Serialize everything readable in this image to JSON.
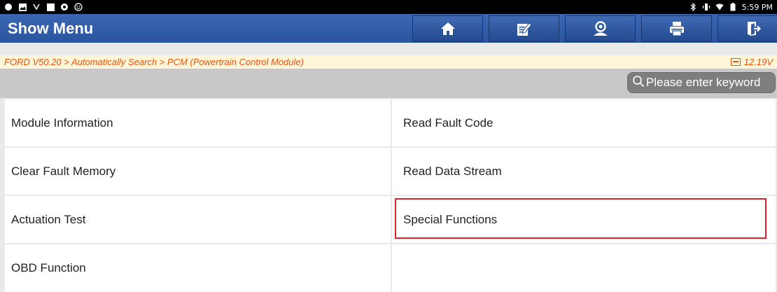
{
  "status_bar": {
    "time": "5:59 PM",
    "left_icons": [
      "app-icon",
      "image-icon",
      "usb-icon",
      "square-icon",
      "location-icon",
      "smiley-icon"
    ],
    "right_icons": [
      "bluetooth-icon",
      "vibrate-icon",
      "wifi-icon",
      "battery-icon"
    ]
  },
  "header": {
    "title": "Show Menu",
    "buttons": [
      "home-icon",
      "edit-report-icon",
      "user-icon",
      "print-icon",
      "exit-icon"
    ]
  },
  "breadcrumb": {
    "path": "FORD V50.20 > Automatically Search > PCM (Powertrain Control Module)",
    "voltage": "12.19V"
  },
  "search": {
    "placeholder": "Please enter keyword"
  },
  "menu": {
    "items": [
      {
        "label": "Module Information"
      },
      {
        "label": "Read Fault Code"
      },
      {
        "label": "Clear Fault Memory"
      },
      {
        "label": "Read Data Stream"
      },
      {
        "label": "Actuation Test"
      },
      {
        "label": "Special Functions",
        "highlighted": true
      },
      {
        "label": "OBD Function"
      },
      {
        "label": ""
      }
    ]
  },
  "colors": {
    "header": "#2f5ba6",
    "breadcrumb_text": "#e8540f",
    "highlight_border": "#e0222b"
  }
}
